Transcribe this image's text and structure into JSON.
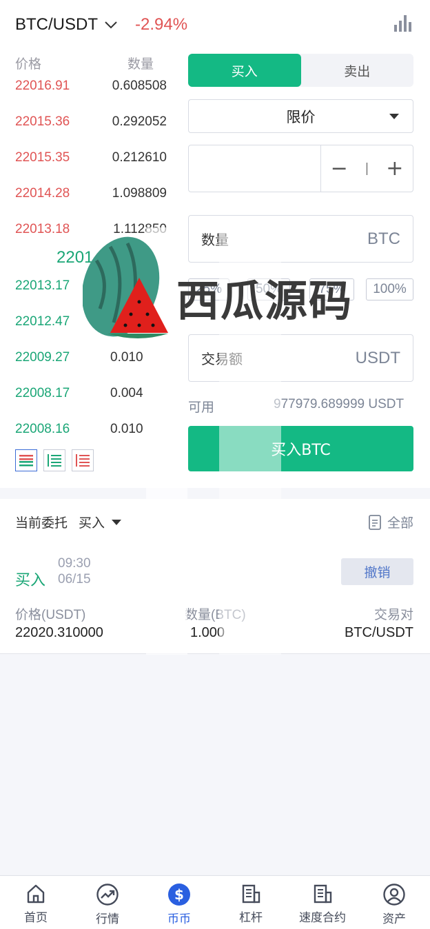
{
  "header": {
    "pair": "BTC/USDT",
    "change_pct": "-2.94%",
    "change_color": "#e05454",
    "icons": {
      "dropdown": "chevron-down-icon",
      "chart": "bar-chart-icon"
    }
  },
  "orderbook": {
    "price_header": "价格",
    "qty_header": "数量",
    "asks": [
      {
        "price": "22016.91",
        "qty": "0.608508"
      },
      {
        "price": "22015.36",
        "qty": "0.292052"
      },
      {
        "price": "22015.35",
        "qty": "0.212610"
      },
      {
        "price": "22014.28",
        "qty": "1.098809"
      },
      {
        "price": "22013.18",
        "qty": "1.112850"
      }
    ],
    "mid_price": "2201",
    "bids": [
      {
        "price": "22013.17",
        "qty": ""
      },
      {
        "price": "22012.47",
        "qty": ""
      },
      {
        "price": "22009.27",
        "qty": "0.010"
      },
      {
        "price": "22008.17",
        "qty": "0.004"
      },
      {
        "price": "22008.16",
        "qty": "0.010"
      }
    ],
    "ask_color": "#e05454",
    "bid_color": "#1aa676"
  },
  "trade": {
    "tab_buy": "买入",
    "tab_sell": "卖出",
    "order_type": "限价",
    "price_value": "",
    "minus": "−",
    "plus": "+",
    "qty_label": "数量",
    "qty_unit": "BTC",
    "pct_buttons": [
      "25%",
      "50%",
      "75%",
      "100%"
    ],
    "amount_label": "交易额",
    "amount_unit": "USDT",
    "available_label": "可用",
    "available_value": "977979.689999 USDT",
    "buy_button": "买入BTC",
    "accent_color": "#14b984"
  },
  "orders": {
    "title": "当前委托",
    "filter": "买入",
    "all_label": "全部",
    "items": [
      {
        "side": "买入",
        "time": "09:30",
        "date": "06/15",
        "cancel_label": "撤销",
        "price_header": "价格(USDT)",
        "qty_header": "数量(BTC)",
        "pair_header": "交易对",
        "price": "22020.310000",
        "qty": "1.000",
        "pair": "BTC/USDT"
      }
    ]
  },
  "watermark": {
    "text": "西瓜源码"
  },
  "nav": {
    "items": [
      {
        "label": "首页",
        "icon": "home-icon"
      },
      {
        "label": "行情",
        "icon": "trend-icon"
      },
      {
        "label": "币币",
        "icon": "dollar-icon"
      },
      {
        "label": "杠杆",
        "icon": "building-icon"
      },
      {
        "label": "速度合约",
        "icon": "building-icon"
      },
      {
        "label": "资产",
        "icon": "user-icon"
      }
    ],
    "active_index": 2,
    "active_color": "#2a5fe0"
  }
}
